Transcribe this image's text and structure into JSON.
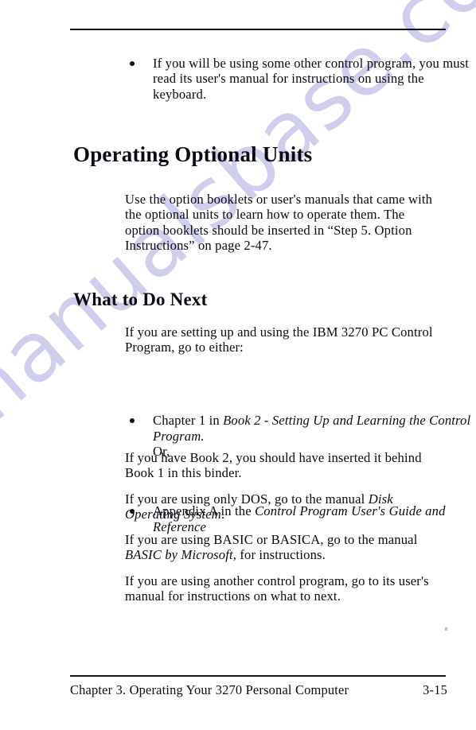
{
  "page": {
    "watermark_text": "manualsbase.com",
    "watermark_color": "#ccccec",
    "text_color": "#0a0a12",
    "background": "#ffffff"
  },
  "top_bullets": [
    "If you will be using some other control program, you must read its user's manual for instructions on using the keyboard."
  ],
  "sections": [
    {
      "heading": "Operating Optional Units",
      "paragraph": "Use the option booklets or user's manuals that came with the optional units to learn how to operate them.  The option booklets should be inserted in “Step 5. Option Instructions” on page  2-47."
    },
    {
      "heading": "What to Do Next",
      "intro": "If you are setting up and using the IBM 3270 PC Control Program, go to either:",
      "bullets": [
        {
          "lead": "Chapter 1 in ",
          "italic": "Book 2 - Setting Up and Learning the Control Program.",
          "trail": "",
          "note": "Or,"
        },
        {
          "lead": "Appendix A in the ",
          "italic": "Control Program User's Guide and Reference",
          "trail": "",
          "note": ""
        }
      ],
      "paragraphs": [
        {
          "lead": "If you have Book 2, you should have inserted it behind Book 1 in this binder.",
          "italic": "",
          "trail": ""
        },
        {
          "lead": "If you are using only DOS, go to the manual ",
          "italic": "Disk Operating System",
          "trail": "."
        },
        {
          "lead": "If you are using BASIC or BASICA, go to the manual ",
          "italic": "BASIC by Microsoft",
          "trail": ", for instructions."
        },
        {
          "lead": "If you are using another control program, go to its user's manual for instructions on what to next.",
          "italic": "",
          "trail": ""
        }
      ]
    }
  ],
  "footer": {
    "title": "Chapter 3.  Operating Your 3270 Personal Computer",
    "page_number": "3-15"
  }
}
